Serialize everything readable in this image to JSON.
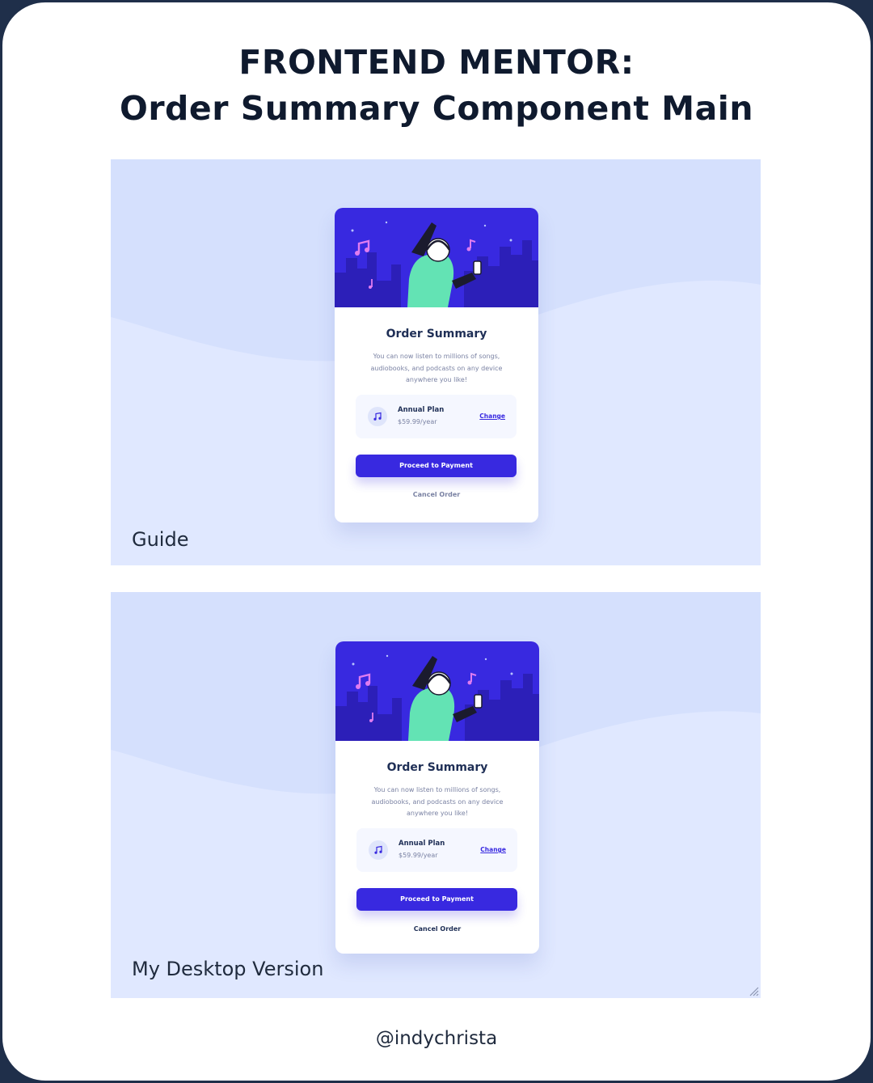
{
  "header": {
    "title_line1": "FRONTEND MENTOR:",
    "title_line2": "Order Summary Component Main"
  },
  "panels": [
    {
      "label": "Guide",
      "card": {
        "title": "Order Summary",
        "description": "You can now listen to millions of songs, audiobooks, and podcasts on any device anywhere you like!",
        "plan_name": "Annual Plan",
        "plan_price": "$59.99/year",
        "change_label": "Change",
        "proceed_label": "Proceed to Payment",
        "cancel_label": "Cancel Order"
      }
    },
    {
      "label": "My Desktop Version",
      "card": {
        "title": "Order Summary",
        "description": "You can now listen to millions of songs, audiobooks, and podcasts on any device anywhere you like!",
        "plan_name": "Annual Plan",
        "plan_price": "$59.99/year",
        "change_label": "Change",
        "proceed_label": "Proceed to Payment",
        "cancel_label": "Cancel Order"
      }
    }
  ],
  "footer": {
    "handle": "@indychrista"
  },
  "colors": {
    "frame": "#1f2f4a",
    "panel_bg": "#e0e8ff",
    "primary": "#3829e0",
    "hero_bg": "#3829e0",
    "figure": "#63e3b4",
    "heading": "#1f2f56",
    "muted": "#7a82a3"
  },
  "icons": [
    "music-note-icon",
    "illustration-hero",
    "resize-grip-icon"
  ]
}
